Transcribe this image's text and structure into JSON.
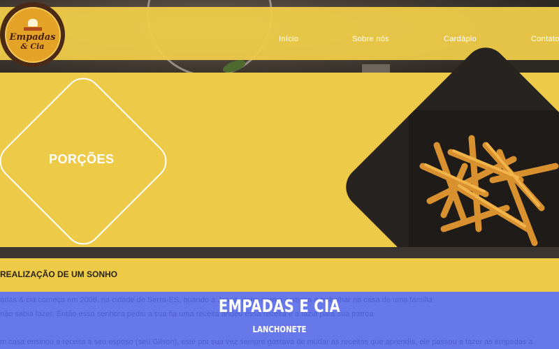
{
  "logo": {
    "line1": "Empadas",
    "line2": "& Cia"
  },
  "nav": {
    "items": [
      "Início",
      "Sobre nós",
      "Cardápio",
      "Contato"
    ]
  },
  "hero": {
    "label": "PORÇÕES"
  },
  "section": {
    "title": "REALIZAÇÃO DE UM SONHO"
  },
  "paragraph": {
    "line1": "adas & cia começa em 2006, na cidade de Serra-ES, quando a                            Jesus, dona norma começa a trabalhar na casa de uma família",
    "line2": "não sabia fazer. Então essa senhora pediu a sua fia uma receita                          andeu essa receita e a fazia para sua patroa",
    "line3": "m casa ensinou a receita a seu esposo (seu Gilson), este por sua vez sempre gostava de mudar as receitas que aprendia, ele passou a fazer as empadas a"
  },
  "footer": {
    "title": "EMPADAS E CIA",
    "subtitle": "LANCHONETE"
  },
  "colors": {
    "yellow": "#edca47",
    "blue": "#6779ea",
    "white": "#ffffff"
  }
}
